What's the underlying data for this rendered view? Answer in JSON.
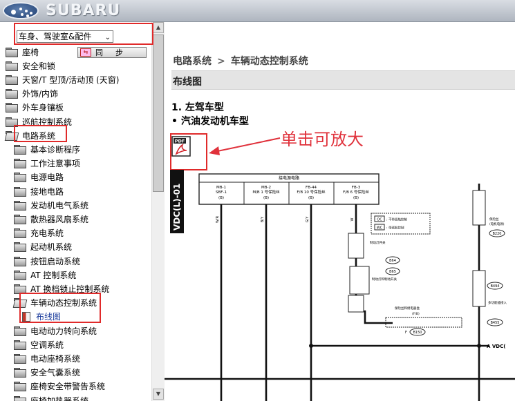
{
  "header": {
    "brand": "SUBARU"
  },
  "sidebar": {
    "category_select": "车身、驾驶室&配件",
    "sync_button": "同步",
    "items": [
      {
        "label": "座椅",
        "level": 0
      },
      {
        "label": "安全和锁",
        "level": 0
      },
      {
        "label": "天窗/T 型顶/活动顶 (天窗)",
        "level": 0
      },
      {
        "label": "外饰/内饰",
        "level": 0
      },
      {
        "label": "外车身镶板",
        "level": 0
      },
      {
        "label": "巡航控制系统",
        "level": 0
      },
      {
        "label": "电路系统",
        "level": 0
      },
      {
        "label": "基本诊断程序",
        "level": 1
      },
      {
        "label": "工作注意事项",
        "level": 1
      },
      {
        "label": "电源电路",
        "level": 1
      },
      {
        "label": "接地电路",
        "level": 1
      },
      {
        "label": "发动机电气系统",
        "level": 1
      },
      {
        "label": "散热器风扇系统",
        "level": 1
      },
      {
        "label": "充电系统",
        "level": 1
      },
      {
        "label": "起动机系统",
        "level": 1
      },
      {
        "label": "按钮启动系统",
        "level": 1
      },
      {
        "label": "AT 控制系统",
        "level": 1
      },
      {
        "label": "AT 换档锁止控制系统",
        "level": 1
      },
      {
        "label": "车辆动态控制系统",
        "level": 1
      },
      {
        "label": "布线图",
        "level": 2
      },
      {
        "label": "电动动力转向系统",
        "level": 1
      },
      {
        "label": "空调系统",
        "level": 1
      },
      {
        "label": "电动座椅系统",
        "level": 1
      },
      {
        "label": "安全气囊系统",
        "level": 1
      },
      {
        "label": "座椅安全带警告系统",
        "level": 1
      },
      {
        "label": "座椅加热器系统",
        "level": 1
      }
    ]
  },
  "content": {
    "breadcrumb": [
      "电路系统",
      "车辆动态控制系统"
    ],
    "breadcrumb_sep": ">",
    "section_title": "布线图",
    "heading1": "1.  左驾车型",
    "heading2": "•  汽油发动机车型",
    "pdf_label": "PDF",
    "annotation": "单击可放大"
  },
  "diagram": {
    "side_label": "VDC(L)-01",
    "header_title": "接电源电路",
    "fuse_boxes": [
      {
        "line1": "MB-1",
        "line2": "SBF-1",
        "line3": "(B)"
      },
      {
        "line1": "MB-2",
        "line2": "M/B 1 号保险丝",
        "line3": "(B)"
      },
      {
        "line1": "FB-44",
        "line2": "F/B 10 号保险丝",
        "line3": "(B)"
      },
      {
        "line1": "FB-3",
        "line2": "F/B 6 号保险丝",
        "line3": "(B)"
      }
    ],
    "wire_labels": [
      "W/R",
      "B/Y",
      "G/Y",
      "W"
    ],
    "legend": [
      {
        "code": "OC",
        "text": ": 不带巡航控制"
      },
      {
        "code": "WC",
        "text": ": 带巡航控制"
      }
    ],
    "connectors": [
      "B64",
      "B65",
      "B220",
      "B494",
      "B150",
      "B455"
    ],
    "labels": {
      "stop_switch": "制动灯开关",
      "stop_sw2": "制动灯和制动开关",
      "brake_relay": "保险丝和继电器盒",
      "fb": "(F/B)",
      "fuse15": "保险丝",
      "fuse15b": "(电机电源)",
      "multi": "多功能插接入",
      "vdc": "A VDC(",
      "fuse_f": "F"
    }
  }
}
